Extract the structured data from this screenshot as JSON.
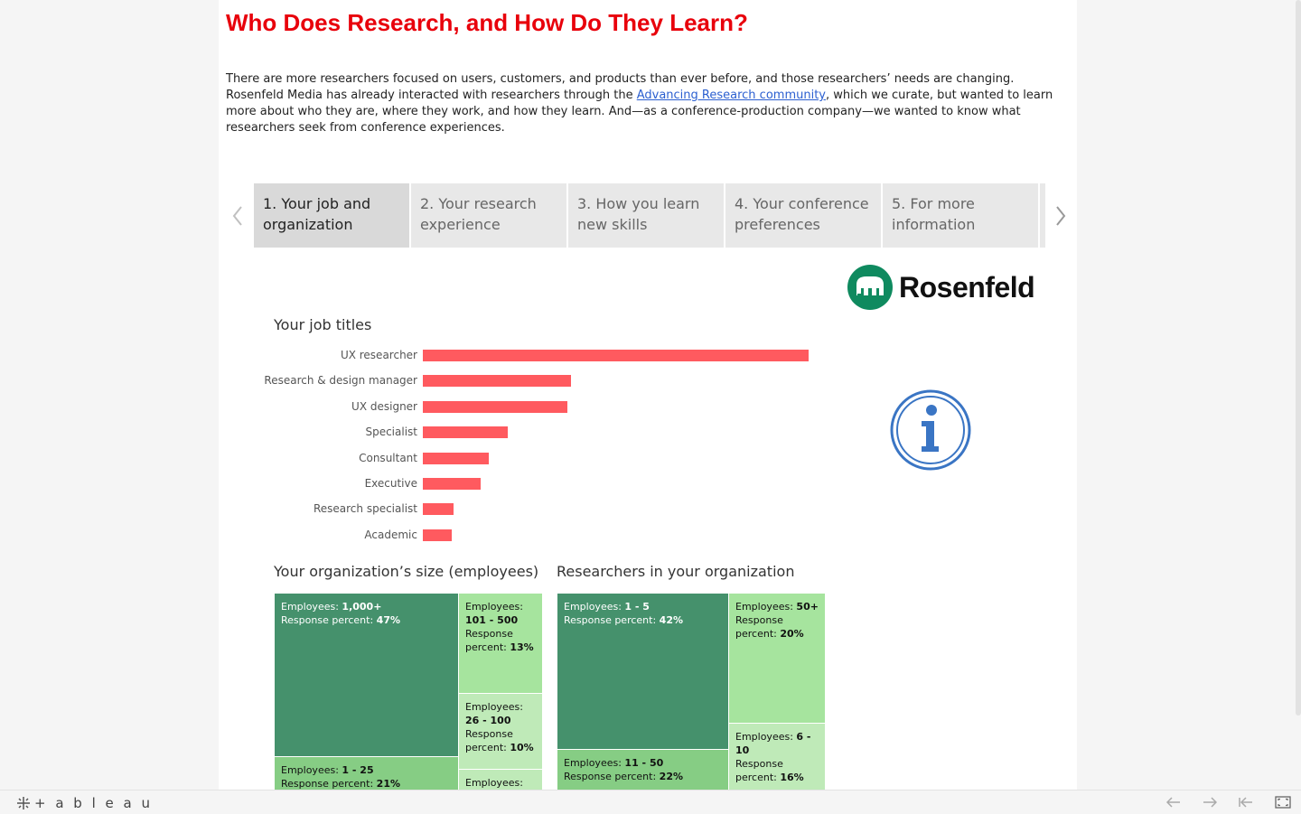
{
  "header": {
    "title": "Who Does Research, and How Do They Learn?",
    "intro_before": "There are more researchers focused on users, customers, and products than ever before, and those researchers’ needs are changing. Rosenfeld Media has already interacted with researchers through the ",
    "intro_link": "Advancing Research community",
    "intro_after": ", which we curate, but wanted to learn more about who they are, where they work, and how they learn. And—as a conference-production company—we wanted to know what researchers seek from conference experiences."
  },
  "tabs": [
    {
      "label": "1. Your job and organization",
      "active": true
    },
    {
      "label": "2. Your research experience",
      "active": false
    },
    {
      "label": " 3. How you learn new skills",
      "active": false
    },
    {
      "label": "4. Your conference preferences",
      "active": false
    },
    {
      "label": "5. For more information",
      "active": false
    }
  ],
  "logo": {
    "text": "Rosenfeld",
    "color": "#0f8a5f",
    "icon": "elephant-icon"
  },
  "info_icon": {
    "icon": "info-icon",
    "color": "#3a75c4"
  },
  "job_titles": {
    "title": "Your job titles",
    "chart_data": {
      "type": "bar",
      "categories": [
        "UX researcher",
        "Research & design manager",
        "UX designer",
        "Specialist",
        "Consultant",
        "Executive",
        "Research specialist",
        "Academic"
      ],
      "values": [
        100,
        38.5,
        37.5,
        22,
        17,
        15,
        8,
        7.5
      ],
      "color": "#ff5a5f",
      "xlabel": "",
      "ylabel": ""
    }
  },
  "org_size": {
    "title": "Your organization’s size (employees)",
    "cells": [
      {
        "key": "Employees:",
        "value": "1,000+",
        "resp_key": "Response percent:",
        "resp_value": "47%"
      },
      {
        "key": "Employees:",
        "value": "101 - 500",
        "resp_key": "Response percent:",
        "resp_value": "13%"
      },
      {
        "key": "Employees:",
        "value": "26 - 100",
        "resp_key": "Response percent:",
        "resp_value": "10%"
      },
      {
        "key": "Employees:",
        "value": "1 - 25",
        "resp_key": "Response percent:",
        "resp_value": "21%"
      },
      {
        "key": "Employees:",
        "value": "",
        "resp_key": "",
        "resp_value": ""
      }
    ]
  },
  "researchers": {
    "title": "Researchers in your organization",
    "cells": [
      {
        "key": "Employees:",
        "value": "1 - 5",
        "resp_key": "Response percent:",
        "resp_value": "42%"
      },
      {
        "key": "Employees:",
        "value": "50+",
        "resp_key": "Response percent:",
        "resp_value": "20%"
      },
      {
        "key": "Employees:",
        "value": "11 - 50",
        "resp_key": "Response percent:",
        "resp_value": "22%"
      },
      {
        "key": "Employees:",
        "value": "6 - 10",
        "resp_key": "Response percent:",
        "resp_value": "16%"
      }
    ]
  },
  "footer": {
    "brand": "+ a b l e a u",
    "buttons": [
      "undo-icon",
      "redo-icon",
      "revert-icon",
      "fullscreen-icon"
    ]
  }
}
